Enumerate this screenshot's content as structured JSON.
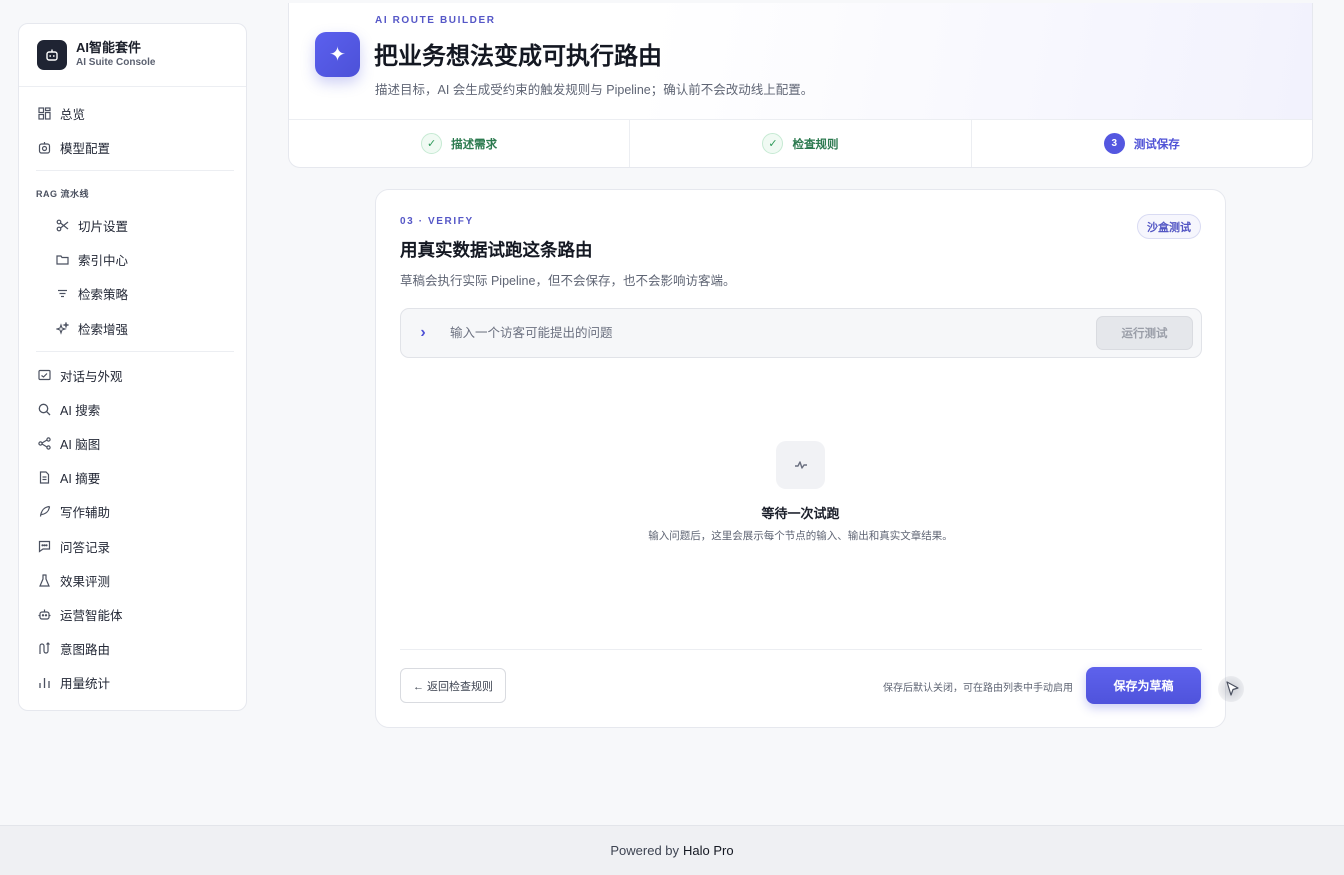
{
  "brand": {
    "title": "AI智能套件",
    "subtitle": "AI Suite Console"
  },
  "sidebar": {
    "top_items": [
      {
        "label": "总览",
        "icon": "grid-icon"
      },
      {
        "label": "模型配置",
        "icon": "model-icon"
      }
    ],
    "section_label": "RAG 流水线",
    "rag_items": [
      {
        "label": "切片设置",
        "icon": "scissors-icon"
      },
      {
        "label": "索引中心",
        "icon": "folder-icon"
      },
      {
        "label": "检索策略",
        "icon": "filter-icon"
      },
      {
        "label": "检索增强",
        "icon": "sparkle-icon"
      }
    ],
    "bottom_items": [
      {
        "label": "对话与外观",
        "icon": "chat-window-icon"
      },
      {
        "label": "AI 搜索",
        "icon": "search-icon"
      },
      {
        "label": "AI 脑图",
        "icon": "mindmap-icon"
      },
      {
        "label": "AI 摘要",
        "icon": "document-icon"
      },
      {
        "label": "写作辅助",
        "icon": "feather-icon"
      },
      {
        "label": "问答记录",
        "icon": "message-icon"
      },
      {
        "label": "效果评测",
        "icon": "flask-icon"
      },
      {
        "label": "运营智能体",
        "icon": "robot-icon"
      },
      {
        "label": "意图路由",
        "icon": "route-icon"
      },
      {
        "label": "用量统计",
        "icon": "bar-chart-icon"
      }
    ]
  },
  "header": {
    "eyebrow": "AI ROUTE BUILDER",
    "title": "把业务想法变成可执行路由",
    "description": "描述目标，AI 会生成受约束的触发规则与 Pipeline；确认前不会改动线上配置。",
    "steps": [
      {
        "label": "描述需求",
        "state": "done"
      },
      {
        "label": "检查规则",
        "state": "done"
      },
      {
        "label": "测试保存",
        "state": "active",
        "number": "3"
      }
    ]
  },
  "verify": {
    "eyebrow": "03 · VERIFY",
    "title": "用真实数据试跑这条路由",
    "description": "草稿会执行实际 Pipeline，但不会保存，也不会影响访客端。",
    "sandbox_tag": "沙盒测试",
    "input_placeholder": "输入一个访客可能提出的问题",
    "input_value": "",
    "run_button": "运行测试",
    "empty_title": "等待一次试跑",
    "empty_description": "输入问题后，这里会展示每个节点的输入、输出和真实文章结果。",
    "back_button": "← 返回检查规则",
    "save_note": "保存后默认关闭，可在路由列表中手动启用",
    "save_button": "保存为草稿"
  },
  "footer": {
    "prefix": "Powered by",
    "brand": "Halo Pro"
  },
  "colors": {
    "accent": "#5457e0",
    "success": "#2f9a5a",
    "sidebar_bg": "#ffffff",
    "page_bg": "#f7f8fa"
  }
}
